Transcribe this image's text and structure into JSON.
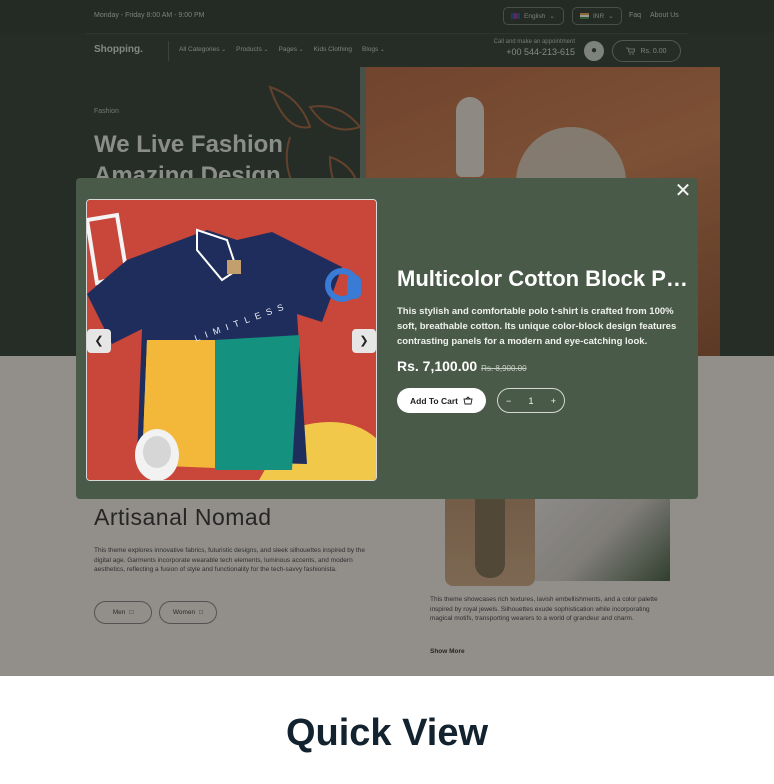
{
  "topbar": {
    "hours": "Monday - Friday  8:00 AM - 9:00 PM",
    "language": "English",
    "currency": "INR",
    "faq": "Faq",
    "about": "About Us"
  },
  "nav": {
    "brand": "Shopping.",
    "items": [
      "All Categories",
      "Products",
      "Pages",
      "Kids Clothing",
      "Blogs"
    ],
    "call_label": "Call and make an appointment",
    "phone": "+00 544-213-615",
    "cart_total": "Rs. 0.00"
  },
  "hero": {
    "kicker": "Fashion",
    "headline": "We Live Fashion Amazing Design"
  },
  "lower": {
    "title": "Artisanal Nomad",
    "paragraph": "This theme explores innovative fabrics, futuristic designs, and sleek silhouettes inspired by the digital age. Garments incorporate wearable tech elements, luminous accents, and modern aesthetics, reflecting a fusion of style and functionality for the tech-savvy fashionista.",
    "btn_men": "Men",
    "btn_women": "Women",
    "paragraph2": "This theme showcases rich textures, lavish embellishments, and a color palette inspired by royal jewels. Silhouettes exude sophistication while incorporating magical motifs, transporting wearers to a world of grandeur and charm.",
    "show_more": "Show More"
  },
  "modal": {
    "close_icon": "close-icon",
    "product_title": "Multicolor Cotton Block Polo T-Shirt",
    "description": "This stylish and comfortable polo t-shirt is crafted from 100% soft, breathable cotton. Its unique color-block design features contrasting panels for a modern and eye-catching look.",
    "price_now": "Rs. 7,100.00",
    "price_was": "Rs. 8,900.00",
    "add_to_cart": "Add To Cart",
    "quantity": "1",
    "qty_minus": "−",
    "qty_plus": "+",
    "shirt_text": "LIMITLESS"
  },
  "caption": "Quick View",
  "colors": {
    "modal_bg": "#4a5a49",
    "hero_bg": "#2c3a2d",
    "caption_text": "#12222f"
  }
}
